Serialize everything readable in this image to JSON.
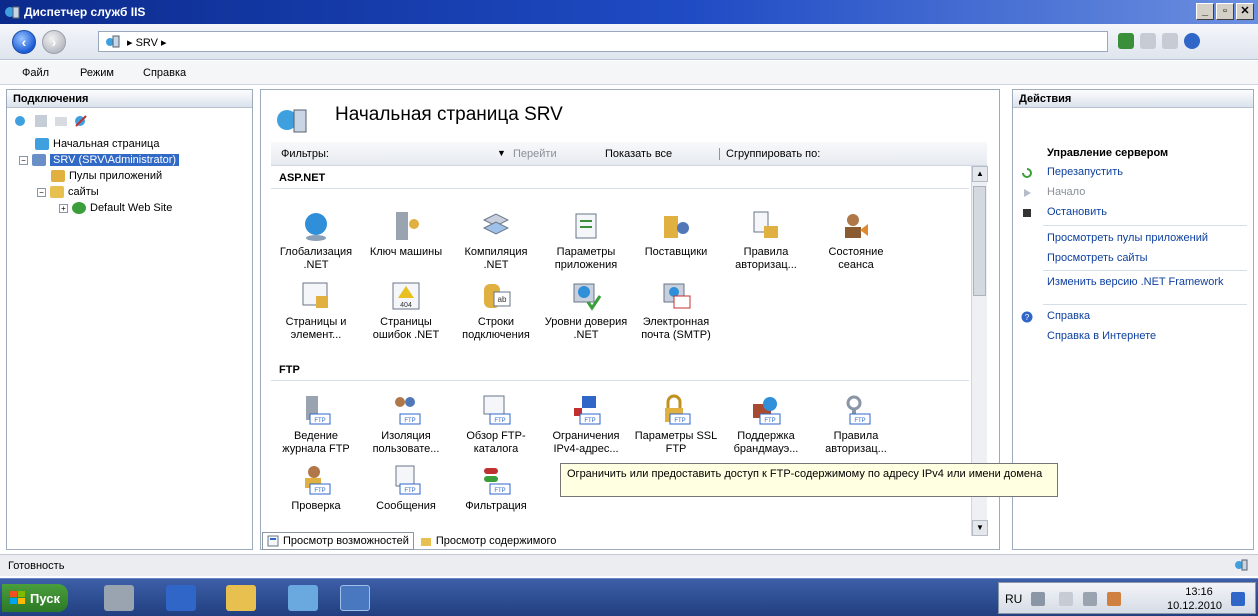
{
  "window": {
    "title": "Диспетчер служб IIS",
    "controls": [
      "_",
      "▫",
      "✕"
    ]
  },
  "address": {
    "crumbs": "▸  SRV  ▸"
  },
  "menu": [
    "Файл",
    "Режим",
    "Справка"
  ],
  "connections": {
    "header": "Подключения",
    "tree": [
      {
        "label": "Начальная страница",
        "icon": "start-page-icon"
      },
      {
        "label": "SRV (SRV\\Administrator)",
        "icon": "server-icon",
        "selected": true
      },
      {
        "label": "Пулы приложений",
        "icon": "app-pools-icon"
      },
      {
        "label": "сайты",
        "icon": "sites-folder-icon"
      },
      {
        "label": "Default Web Site",
        "icon": "globe-icon"
      }
    ]
  },
  "center": {
    "title": "Начальная страница SRV",
    "filter_label": "Фильтры:",
    "goto": "Перейти",
    "show_all": "Показать все",
    "group_by": "Сгруппировать по:",
    "sections": [
      {
        "title": "ASP.NET",
        "items": [
          {
            "label": "Глобализация .NET",
            "icon": "globe-icon"
          },
          {
            "label": "Ключ машины",
            "icon": "key-icon"
          },
          {
            "label": "Компиляция .NET",
            "icon": "compile-icon"
          },
          {
            "label": "Параметры приложения",
            "icon": "app-settings-icon"
          },
          {
            "label": "Поставщики",
            "icon": "providers-icon"
          },
          {
            "label": "Правила авторизац...",
            "icon": "lock-icon"
          },
          {
            "label": "Состояние сеанса",
            "icon": "user-icon"
          },
          {
            "label": "Страницы и элемент...",
            "icon": "pages-icon"
          },
          {
            "label": "Страницы ошибок .NET",
            "icon": "error-page-icon"
          },
          {
            "label": "Строки подключения",
            "icon": "database-icon"
          },
          {
            "label": "Уровни доверия .NET",
            "icon": "trust-icon"
          },
          {
            "label": "Электронная почта (SMTP)",
            "icon": "mail-icon"
          }
        ]
      },
      {
        "title": "FTP",
        "items": [
          {
            "label": "Ведение журнала FTP",
            "icon": "ftp-log-icon"
          },
          {
            "label": "Изоляция пользовате...",
            "icon": "ftp-users-icon"
          },
          {
            "label": "Обзор FTP-каталога",
            "icon": "ftp-browse-icon"
          },
          {
            "label": "Ограничения IPv4-адрес...",
            "icon": "ftp-ip-icon"
          },
          {
            "label": "Параметры SSL FTP",
            "icon": "ftp-ssl-icon"
          },
          {
            "label": "Поддержка брандмауэ...",
            "icon": "ftp-firewall-icon"
          },
          {
            "label": "Правила авторизац...",
            "icon": "ftp-auth-icon"
          },
          {
            "label": "Проверка",
            "icon": "ftp-check-icon"
          },
          {
            "label": "Сообщения",
            "icon": "ftp-messages-icon"
          },
          {
            "label": "Фильтрация",
            "icon": "ftp-filter-icon"
          }
        ]
      }
    ],
    "tooltip": "Ограничить или предоставить доступ к FTP-содержимому по адресу IPv4 или имени домена",
    "view_features": "Просмотр возможностей",
    "view_content": "Просмотр содержимого"
  },
  "actions": {
    "header": "Действия",
    "manage": "Управление сервером",
    "restart": "Перезапустить",
    "start": "Начало",
    "stop": "Остановить",
    "view_pools": "Просмотреть пулы приложений",
    "view_sites": "Просмотреть сайты",
    "change_net": "Изменить версию .NET Framework",
    "help": "Справка",
    "online_help": "Справка в Интернете"
  },
  "status": {
    "text": "Готовность"
  },
  "taskbar": {
    "start": "Пуск",
    "lang": "RU",
    "time": "13:16",
    "date": "10.12.2010"
  },
  "colors": {
    "titlebar": "#0b2a8c",
    "selection": "#3169c6",
    "link": "#0d3f9e",
    "tooltip_bg": "#ffffe1"
  }
}
